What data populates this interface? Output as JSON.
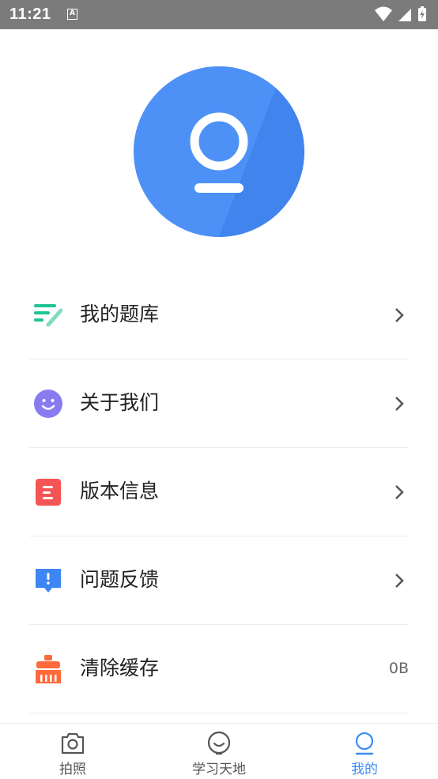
{
  "status_bar": {
    "time": "11:21",
    "notification_icon": "A"
  },
  "profile": {
    "avatar_icon": "user-avatar-icon",
    "avatar_color": "#4a8df5"
  },
  "menu": {
    "items": [
      {
        "label": "我的题库",
        "icon": "question-bank-icon",
        "color": "#1dc494",
        "chevron": true
      },
      {
        "label": "关于我们",
        "icon": "smile-icon",
        "color": "#8a7cf0",
        "chevron": true
      },
      {
        "label": "版本信息",
        "icon": "document-icon",
        "color": "#f55454",
        "chevron": true
      },
      {
        "label": "问题反馈",
        "icon": "feedback-icon",
        "color": "#3e86f5",
        "chevron": true
      },
      {
        "label": "清除缓存",
        "icon": "broom-icon",
        "color": "#ff6a3c",
        "value": "0B"
      }
    ]
  },
  "bottom_nav": {
    "items": [
      {
        "label": "拍照",
        "icon": "camera-icon",
        "active": false
      },
      {
        "label": "学习天地",
        "icon": "study-face-icon",
        "active": false
      },
      {
        "label": "我的",
        "icon": "profile-icon",
        "active": true
      }
    ],
    "active_color": "#3a8bf5"
  }
}
